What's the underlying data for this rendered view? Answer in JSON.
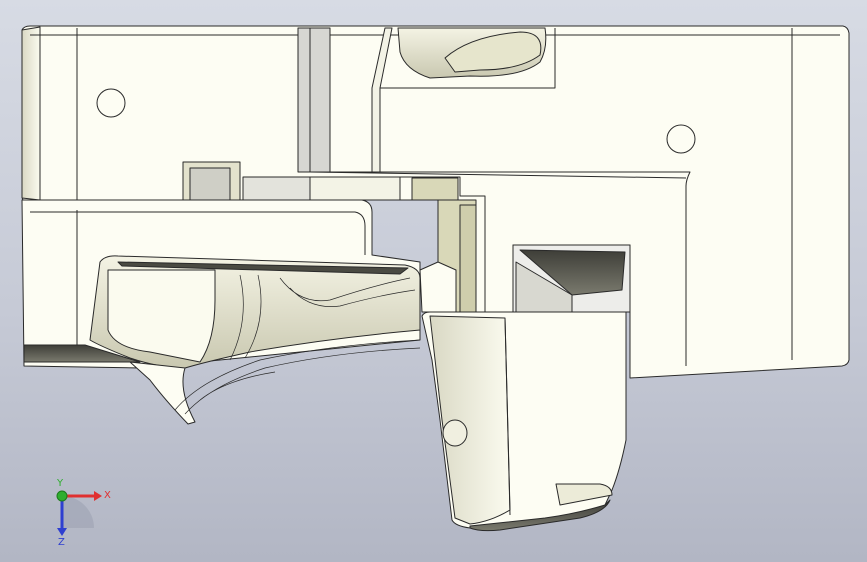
{
  "triad": {
    "x_label": "X",
    "y_label": "Y",
    "z_label": "Z",
    "x_color": "#e03030",
    "y_color": "#2fae2f",
    "z_color": "#2e3fd0"
  },
  "model": {
    "face_color": "#fdfdf3",
    "edge_color": "#2a2a2a",
    "shadow_face_color": "#d0d0c0",
    "dark_face_color": "#5a5a50",
    "olive_face_color": "#d9d8b8"
  },
  "background": {
    "top": "#d7dbe4",
    "bottom": "#b2b6c4"
  }
}
